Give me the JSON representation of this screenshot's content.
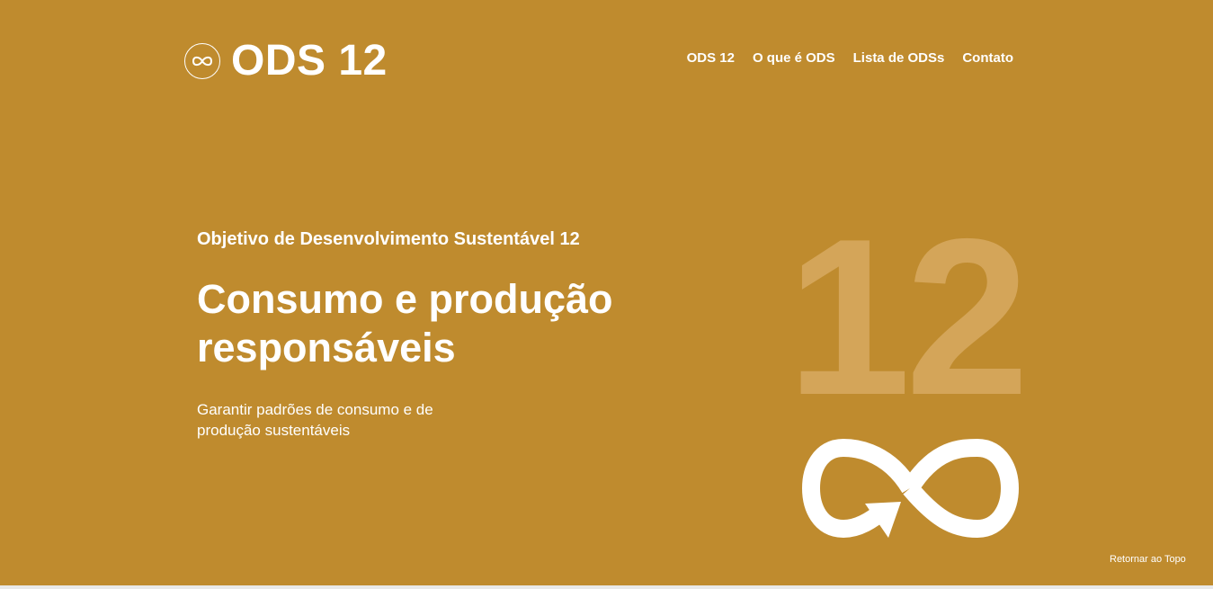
{
  "header": {
    "logo_text": "ODS 12",
    "logo_icon": "infinity-icon"
  },
  "nav": {
    "items": [
      {
        "label": "ODS 12"
      },
      {
        "label": "O que é ODS"
      },
      {
        "label": "Lista de ODSs"
      },
      {
        "label": "Contato"
      }
    ]
  },
  "hero": {
    "eyebrow": "Objetivo de Desenvolvimento Sustentável 12",
    "title_line1": "Consumo e produção",
    "title_line2": "responsáveis",
    "desc_line1": "Garantir padrões de consumo e de",
    "desc_line2": "produção sustentáveis",
    "big_number": "12",
    "emblem_icon": "infinity-arrow-icon"
  },
  "footer": {
    "back_to_top": "Retornar ao Topo"
  },
  "colors": {
    "background": "#BF8B2E",
    "number_tint": "#D4A559",
    "text": "#FFFFFF"
  }
}
